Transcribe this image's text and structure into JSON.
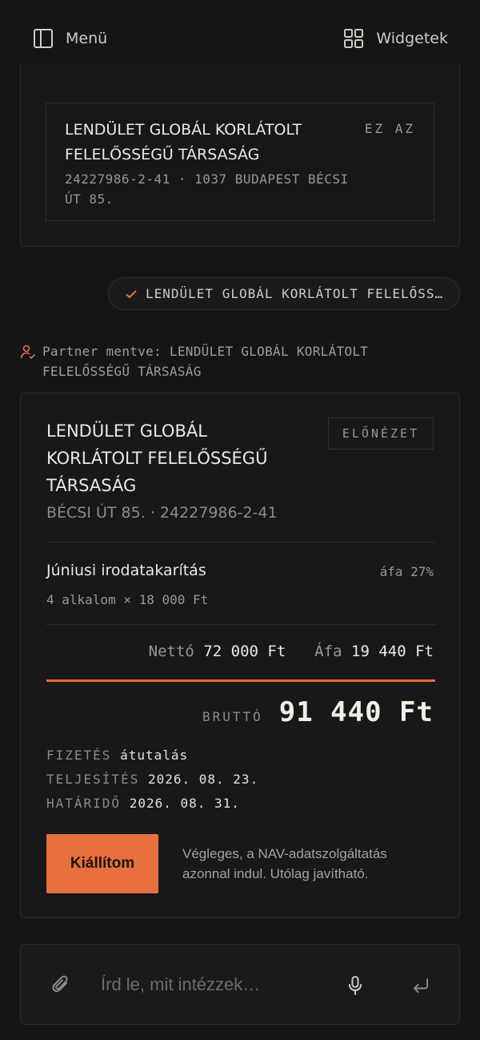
{
  "header": {
    "menu_label": "Menü",
    "widgets_label": "Widgetek"
  },
  "partner_option": {
    "name": "LENDÜLET GLOBÁL KORLÁTOLT FELELŐSSÉGŰ TÁRSASÁG",
    "meta": "24227986-2-41 · 1037 BUDAPEST BÉCSI ÚT 85.",
    "choose_label": "EZ AZ"
  },
  "selected_chip": {
    "text": "LENDÜLET GLOBÁL KORLÁTOLT FELELŐSSÉGŰ TÁRSASÁG"
  },
  "saved_note": {
    "text": "Partner mentve: LENDÜLET GLOBÁL KORLÁTOLT FELELŐSSÉGŰ TÁRSASÁG"
  },
  "invoice": {
    "partner_name": "LENDÜLET GLOBÁL KORLÁTOLT FELELŐSSÉGŰ TÁRSASÁG",
    "partner_address": "BÉCSI ÚT 85. · 24227986-2-41",
    "preview_label": "ELŐNÉZET",
    "item": {
      "title": "Júniusi irodatakarítás",
      "vat": "áfa 27%",
      "quantity": "4 alkalom × 18 000 Ft"
    },
    "totals": {
      "net_label": "Nettó",
      "net_value": "72 000 Ft",
      "vat_label": "Áfa",
      "vat_value": "19 440 Ft"
    },
    "gross_label": "BRUTTÓ",
    "gross_value": "91 440 Ft",
    "payment_label": "FIZETÉS",
    "payment_value": "átutalás",
    "fulfillment_label": "TELJESÍTÉS",
    "fulfillment_value": "2026. 08. 23.",
    "due_label": "HATÁRIDŐ",
    "due_value": "2026. 08. 31.",
    "issue_label": "Kiállítom",
    "issue_note": "Végleges, a NAV-adatszolgáltatás azonnal indul. Utólag javítható."
  },
  "composer": {
    "placeholder": "Írd le, mit intézzek…",
    "value": ""
  },
  "colors": {
    "background": "#151515",
    "accent": "#e8703f"
  }
}
